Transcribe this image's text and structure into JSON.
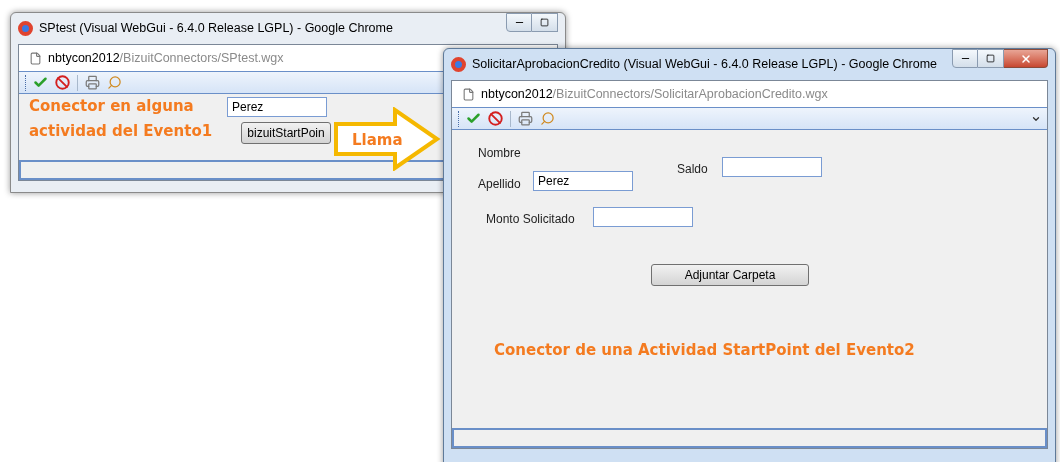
{
  "windows": [
    {
      "title": "SPtest (Visual WebGui - 6.4.0 Release LGPL) - Google Chrome",
      "host": "nbtycon2012",
      "path": "/BizuitConnectors/SPtest.wgx",
      "active": false,
      "controls": [
        {
          "kind": "note",
          "text": "Conector en alguna actividad del Evento1"
        },
        {
          "kind": "input",
          "value": "Perez"
        },
        {
          "kind": "button",
          "text": "bizuitStartPoin"
        }
      ]
    },
    {
      "title": "SolicitarAprobacionCredito (Visual WebGui - 6.4.0 Release LGPL) - Google Chrome",
      "host": "nbtycon2012",
      "path": "/BizuitConnectors/SolicitarAprobacionCredito.wgx",
      "active": true,
      "controls": [
        {
          "kind": "label",
          "text": "Nombre"
        },
        {
          "kind": "label",
          "text": "Saldo"
        },
        {
          "kind": "input"
        },
        {
          "kind": "label",
          "text": "Apellido"
        },
        {
          "kind": "input",
          "value": "Perez"
        },
        {
          "kind": "label",
          "text": "Monto Solicitado"
        },
        {
          "kind": "input"
        },
        {
          "kind": "button",
          "text": "Adjuntar Carpeta"
        },
        {
          "kind": "note",
          "text": "Conector de una Actividad StartPoint del Evento2"
        }
      ]
    }
  ],
  "arrow_label": "Llama"
}
